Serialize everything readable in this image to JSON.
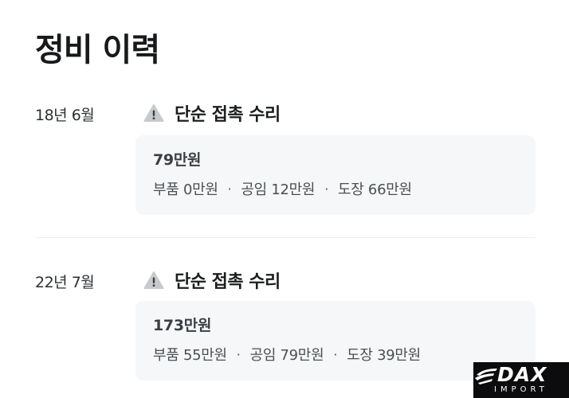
{
  "page": {
    "title": "정비 이력"
  },
  "records": [
    {
      "date": "18년 6월",
      "type_label": "단순 접촉 수리",
      "icon": "warning-icon",
      "total": "79만원",
      "breakdown": {
        "parts": "부품 0만원",
        "labor": "공임 12만원",
        "paint": "도장 66만원"
      }
    },
    {
      "date": "22년 7월",
      "type_label": "단순 접촉 수리",
      "icon": "warning-icon",
      "total": "173만원",
      "breakdown": {
        "parts": "부품 55만원",
        "labor": "공임 79만원",
        "paint": "도장 39만원"
      }
    }
  ],
  "separator": "·",
  "brand": {
    "name": "DAX",
    "sub": "IMPORT"
  },
  "colors": {
    "card_bg": "#f6f7f9",
    "warning_fill": "#c7cacd",
    "warning_mark": "#3a3d41",
    "divider": "#eceef0"
  }
}
